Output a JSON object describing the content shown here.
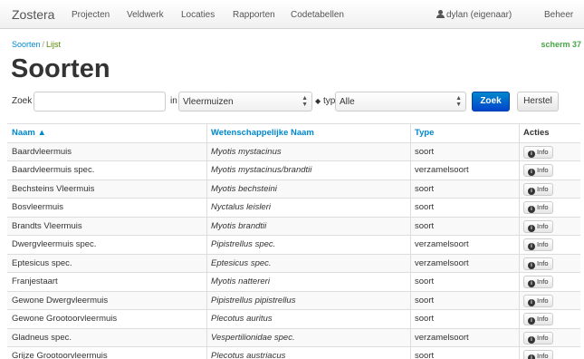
{
  "navbar": {
    "brand": "Zostera",
    "links": [
      "Projecten",
      "Veldwerk",
      "Locaties",
      "Rapporten",
      "Codetabellen"
    ],
    "user": "dylan (eigenaar)",
    "admin": "Beheer"
  },
  "breadcrumb": {
    "parent": "Soorten",
    "separator": "/",
    "current": "Lijst"
  },
  "screen_id": "scherm 37",
  "page_title": "Soorten",
  "search": {
    "zoek_label": "Zoek",
    "query": "",
    "in_label": "in",
    "group_selected": "Vleermuizen",
    "type_label": "type",
    "type_selected": "Alle",
    "submit_label": "Zoek",
    "reset_label": "Herstel"
  },
  "table": {
    "headers": [
      "Naam ▲",
      "Wetenschappelijke Naam",
      "Type",
      "Acties"
    ],
    "info_label": "Info",
    "rows": [
      {
        "naam": "Baardvleermuis",
        "wetenschappelijk": "Myotis mystacinus",
        "type": "soort"
      },
      {
        "naam": "Baardvleermuis spec.",
        "wetenschappelijk": "Myotis mystacinus/brandtii",
        "type": "verzamelsoort"
      },
      {
        "naam": "Bechsteins Vleermuis",
        "wetenschappelijk": "Myotis bechsteini",
        "type": "soort"
      },
      {
        "naam": "Bosvleermuis",
        "wetenschappelijk": "Nyctalus leisleri",
        "type": "soort"
      },
      {
        "naam": "Brandts Vleermuis",
        "wetenschappelijk": "Myotis brandtii",
        "type": "soort"
      },
      {
        "naam": "Dwergvleermuis spec.",
        "wetenschappelijk": "Pipistrellus spec.",
        "type": "verzamelsoort"
      },
      {
        "naam": "Eptesicus spec.",
        "wetenschappelijk": "Eptesicus spec.",
        "type": "verzamelsoort"
      },
      {
        "naam": "Franjestaart",
        "wetenschappelijk": "Myotis nattereri",
        "type": "soort"
      },
      {
        "naam": "Gewone Dwergvleermuis",
        "wetenschappelijk": "Pipistrellus pipistrellus",
        "type": "soort"
      },
      {
        "naam": "Gewone Grootoorvleermuis",
        "wetenschappelijk": "Plecotus auritus",
        "type": "soort"
      },
      {
        "naam": "Gladneus spec.",
        "wetenschappelijk": "Vespertilionidae spec.",
        "type": "verzamelsoort"
      },
      {
        "naam": "Grijze Grootoorvleermuis",
        "wetenschappelijk": "Plecotus austriacus",
        "type": "soort"
      }
    ]
  }
}
